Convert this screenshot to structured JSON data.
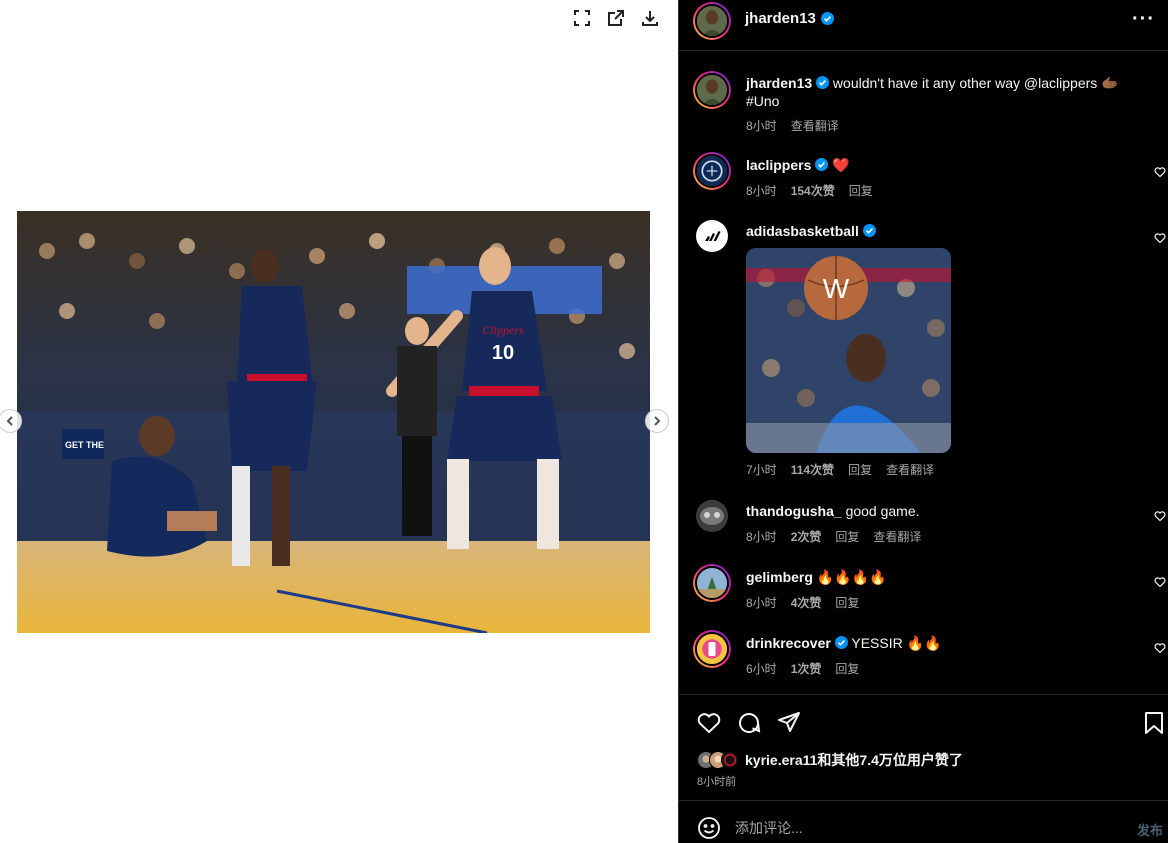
{
  "header": {
    "username": "jharden13",
    "more_label": "···"
  },
  "caption": {
    "username": "jharden13",
    "text": "wouldn't have it any other way @laclippers 🫱🏾 #Uno",
    "time": "8小时",
    "translate": "查看翻译"
  },
  "comments": [
    {
      "username": "laclippers",
      "verified": true,
      "text": "❤️",
      "time": "8小时",
      "likes": "154次赞",
      "reply": "回复",
      "translate": ""
    },
    {
      "username": "adidasbasketball",
      "verified": true,
      "text": "",
      "gif_letter": "W",
      "time": "7小时",
      "likes": "114次赞",
      "reply": "回复",
      "translate": "查看翻译"
    },
    {
      "username": "thandogusha_",
      "verified": false,
      "text": "good game.",
      "time": "8小时",
      "likes": "2次赞",
      "reply": "回复",
      "translate": "查看翻译"
    },
    {
      "username": "gelimberg",
      "verified": false,
      "text": "🔥🔥🔥🔥",
      "time": "8小时",
      "likes": "4次赞",
      "reply": "回复",
      "translate": ""
    },
    {
      "username": "drinkrecover",
      "verified": true,
      "text": "YESSIR 🔥🔥",
      "time": "6小时",
      "likes": "1次赞",
      "reply": "回复",
      "translate": ""
    }
  ],
  "photo": {
    "jersey_number": "10",
    "jersey_text": "Clippers",
    "court_text": "GET THE"
  },
  "likes": {
    "text": "kyrie.era11和其他7.4万位用户赞了",
    "time": "8小时前"
  },
  "composer": {
    "placeholder": "添加评论...",
    "post_label": "发布"
  },
  "colors": {
    "background": "#000000",
    "verified": "#0095f6",
    "muted_text": "#a8a8a8",
    "post_disabled": "#4a5d73"
  }
}
